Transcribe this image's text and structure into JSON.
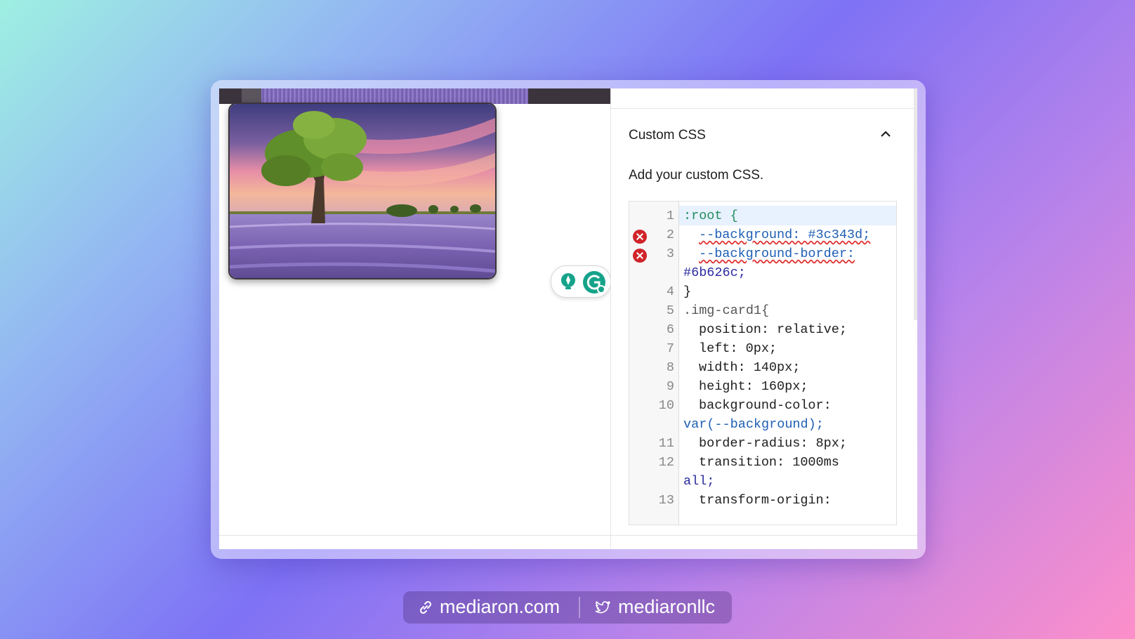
{
  "panel": {
    "title": "Custom CSS",
    "help_text": "Add your custom CSS."
  },
  "editor": {
    "lines": [
      {
        "num": "1",
        "text": ":root {"
      },
      {
        "num": "2",
        "text": "--background: #3c343d;",
        "error": true
      },
      {
        "num": "3",
        "text": "--background-border:",
        "error": true
      },
      {
        "num": "",
        "text": "#6b626c;"
      },
      {
        "num": "4",
        "text": "}"
      },
      {
        "num": "5",
        "text": ".img-card1{"
      },
      {
        "num": "6",
        "text": "position: relative;"
      },
      {
        "num": "7",
        "text": "left: 0px;"
      },
      {
        "num": "8",
        "text": "width: 140px;"
      },
      {
        "num": "9",
        "text": "height: 160px;"
      },
      {
        "num": "10",
        "text": "background-color:"
      },
      {
        "num": "",
        "text": "var(--background);"
      },
      {
        "num": "11",
        "text": "border-radius: 8px;"
      },
      {
        "num": "12",
        "text": "transition: 1000ms"
      },
      {
        "num": "",
        "text": "all;"
      },
      {
        "num": "13",
        "text": "transform-origin:"
      }
    ]
  },
  "social": {
    "website": "mediaron.com",
    "twitter": "mediaronllc"
  },
  "colors": {
    "error": "#d0242a",
    "active_line": "#e8f1fe",
    "grammarly": "#15a38a"
  },
  "icons": {
    "image": "lavender-tree-image",
    "bulb": "lightbulb-icon",
    "grammarly": "grammarly-icon",
    "chevron": "chevron-up-icon",
    "link": "link-icon",
    "twitter": "twitter-bird-icon"
  }
}
